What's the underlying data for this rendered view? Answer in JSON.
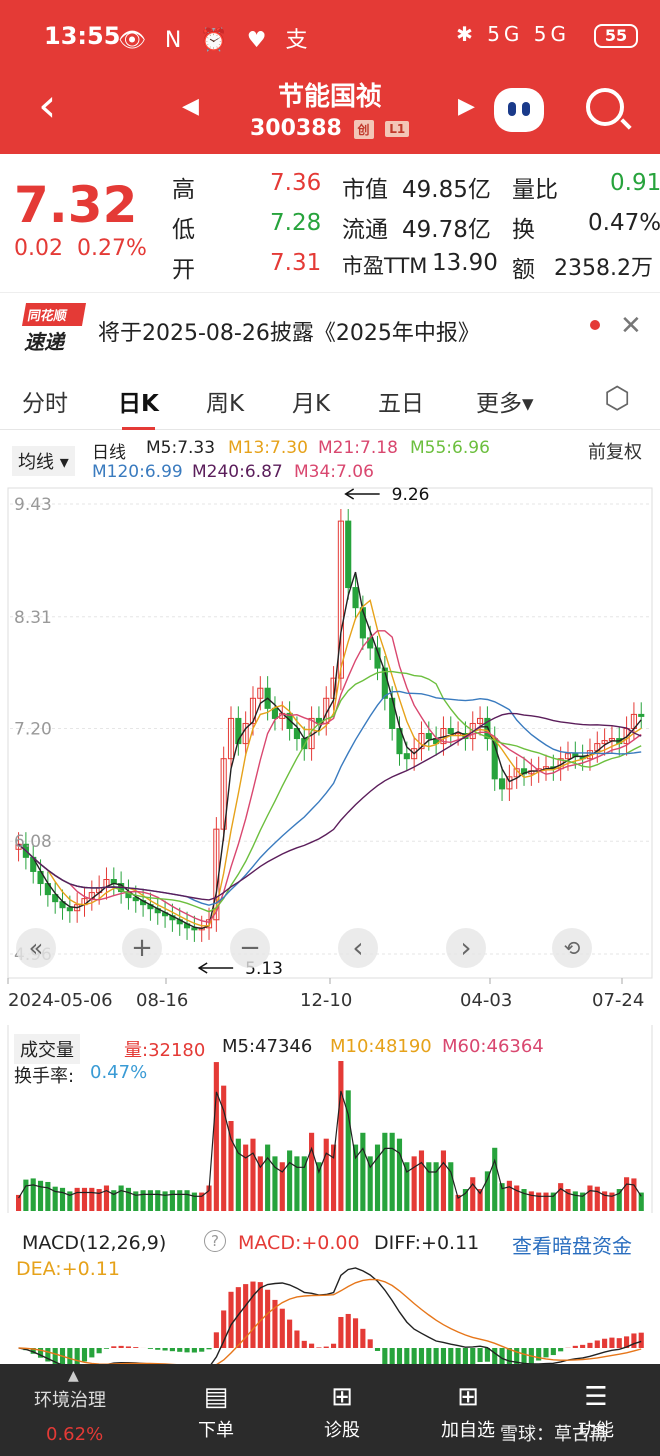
{
  "statusbar": {
    "time": "13:55",
    "battery": "55",
    "icons_left": "👁 N ⏰ ♥ 支",
    "icons_right": "✱ 5G 5G"
  },
  "header": {
    "title": "节能国祯",
    "code": "300388",
    "badge1": "创",
    "badge2": "L1"
  },
  "quote": {
    "price": "7.32",
    "change": "0.02",
    "change_pct": "0.27%",
    "high_label": "高",
    "high": "7.36",
    "low_label": "低",
    "low": "7.28",
    "open_label": "开",
    "open": "7.31",
    "mktcap_label": "市值",
    "mktcap": "49.85亿",
    "float_label": "流通",
    "float": "49.78亿",
    "pe_label": "市盈TTM",
    "pe": "13.90",
    "volratio_label": "量比",
    "volratio": "0.91",
    "turnover_label": "换",
    "turnover": "0.47%",
    "amount_label": "额",
    "amount": "2358.2万"
  },
  "notice": {
    "logo1": "同花顺",
    "logo2": "速递",
    "text": "将于2025-08-26披露《2025年中报》"
  },
  "tabs": [
    "分时",
    "日K",
    "周K",
    "月K",
    "五日",
    "更多▾"
  ],
  "ma": {
    "selector": "均线 ▾",
    "period": "日线",
    "m5": "M5:7.33",
    "m13": "M13:7.30",
    "m21": "M21:7.18",
    "m55": "M55:6.96",
    "m120": "M120:6.99",
    "m240": "M240:6.87",
    "m34": "M34:7.06",
    "adjust": "前复权"
  },
  "colors": {
    "up": "#e43a36",
    "down": "#27a33c",
    "m5": "#222222",
    "m13": "#e6a21a",
    "m21": "#d9476f",
    "m55": "#6cbf3e",
    "m120": "#3a7bbf",
    "m240": "#5b1e5b"
  },
  "chart_data": [
    {
      "type": "candlestick",
      "title": "",
      "y_ticks": [
        "9.43",
        "8.31",
        "7.20",
        "6.08",
        "4.96"
      ],
      "ylim": [
        4.96,
        9.43
      ],
      "x_ticks": [
        "2024-05-06",
        "08-16",
        "12-10",
        "04-03",
        "07-24"
      ],
      "annotations": [
        {
          "label": "9.26",
          "value": 9.26
        },
        {
          "label": "5.13",
          "value": 5.13
        }
      ],
      "closes": [
        6.05,
        5.92,
        5.78,
        5.66,
        5.55,
        5.48,
        5.42,
        5.39,
        5.45,
        5.51,
        5.57,
        5.62,
        5.7,
        5.66,
        5.58,
        5.52,
        5.49,
        5.45,
        5.41,
        5.37,
        5.34,
        5.3,
        5.26,
        5.22,
        5.2,
        5.22,
        5.3,
        6.2,
        6.9,
        7.3,
        7.05,
        7.25,
        7.5,
        7.6,
        7.4,
        7.3,
        7.35,
        7.2,
        7.1,
        7.0,
        7.3,
        7.25,
        7.5,
        7.7,
        9.26,
        8.6,
        8.4,
        8.1,
        8.0,
        7.8,
        7.5,
        7.2,
        6.95,
        6.9,
        7.0,
        7.15,
        7.1,
        7.05,
        7.2,
        7.15,
        7.15,
        7.1,
        7.25,
        7.3,
        7.1,
        6.7,
        6.6,
        6.72,
        6.8,
        6.75,
        6.78,
        6.8,
        6.82,
        6.8,
        6.9,
        6.95,
        6.92,
        6.9,
        6.98,
        7.05,
        7.08,
        7.1,
        7.05,
        7.2,
        7.34,
        7.32
      ]
    },
    {
      "type": "bar",
      "title": "成交量",
      "labels": {
        "vol": "量:32180",
        "m5": "M5:47346",
        "m10": "M10:48190",
        "m60": "M60:46364",
        "turnover_label": "换手率:",
        "turnover": "0.47%"
      }
    },
    {
      "type": "bar",
      "title": "MACD(12,26,9)",
      "labels": {
        "macd": "MACD:+0.00",
        "diff": "DIFF:+0.11",
        "dea": "DEA:+0.11",
        "link": "查看暗盘资金"
      }
    }
  ],
  "controls": {
    "zoom_out": "−",
    "zoom_in": "+",
    "prev": "‹",
    "next": "›"
  },
  "bottombar": {
    "industry": "环境治理",
    "industry_pct": "0.62%",
    "items": [
      "下单",
      "诊股",
      "加自选",
      "功能"
    ]
  },
  "watermark": "雪球：草古斋"
}
